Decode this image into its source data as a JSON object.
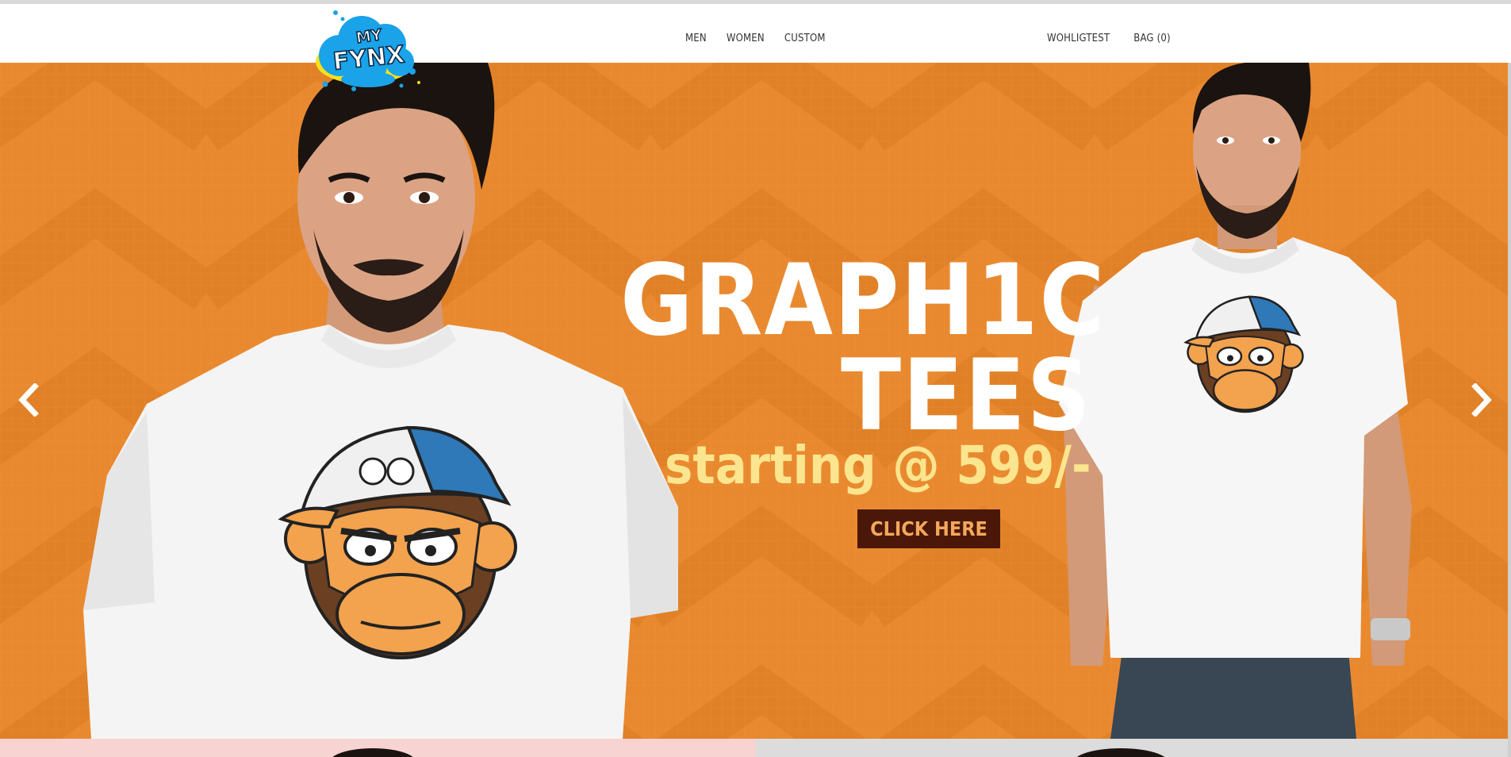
{
  "brand": {
    "logo_alt": "My Fynx",
    "logo_top": "MY",
    "logo_main": "FYNX"
  },
  "nav": {
    "left": [
      "MEN",
      "WOMEN",
      "CUSTOM"
    ],
    "right": [
      "WOHLIGTEST",
      "BAG (0)"
    ]
  },
  "hero": {
    "headline_line1": "GRAPH1C",
    "headline_line2": "TEES",
    "subline": "starting @ 599/-",
    "cta": "CLICK HERE"
  },
  "colors": {
    "hero_orange": "#e9892f",
    "cta_bg": "#4a1709",
    "cta_text": "#f3a85a",
    "subline": "#fbe58e",
    "logo_blue": "#1aa3e8"
  },
  "icons": {
    "prev": "chevron-left-icon",
    "next": "chevron-right-icon"
  }
}
